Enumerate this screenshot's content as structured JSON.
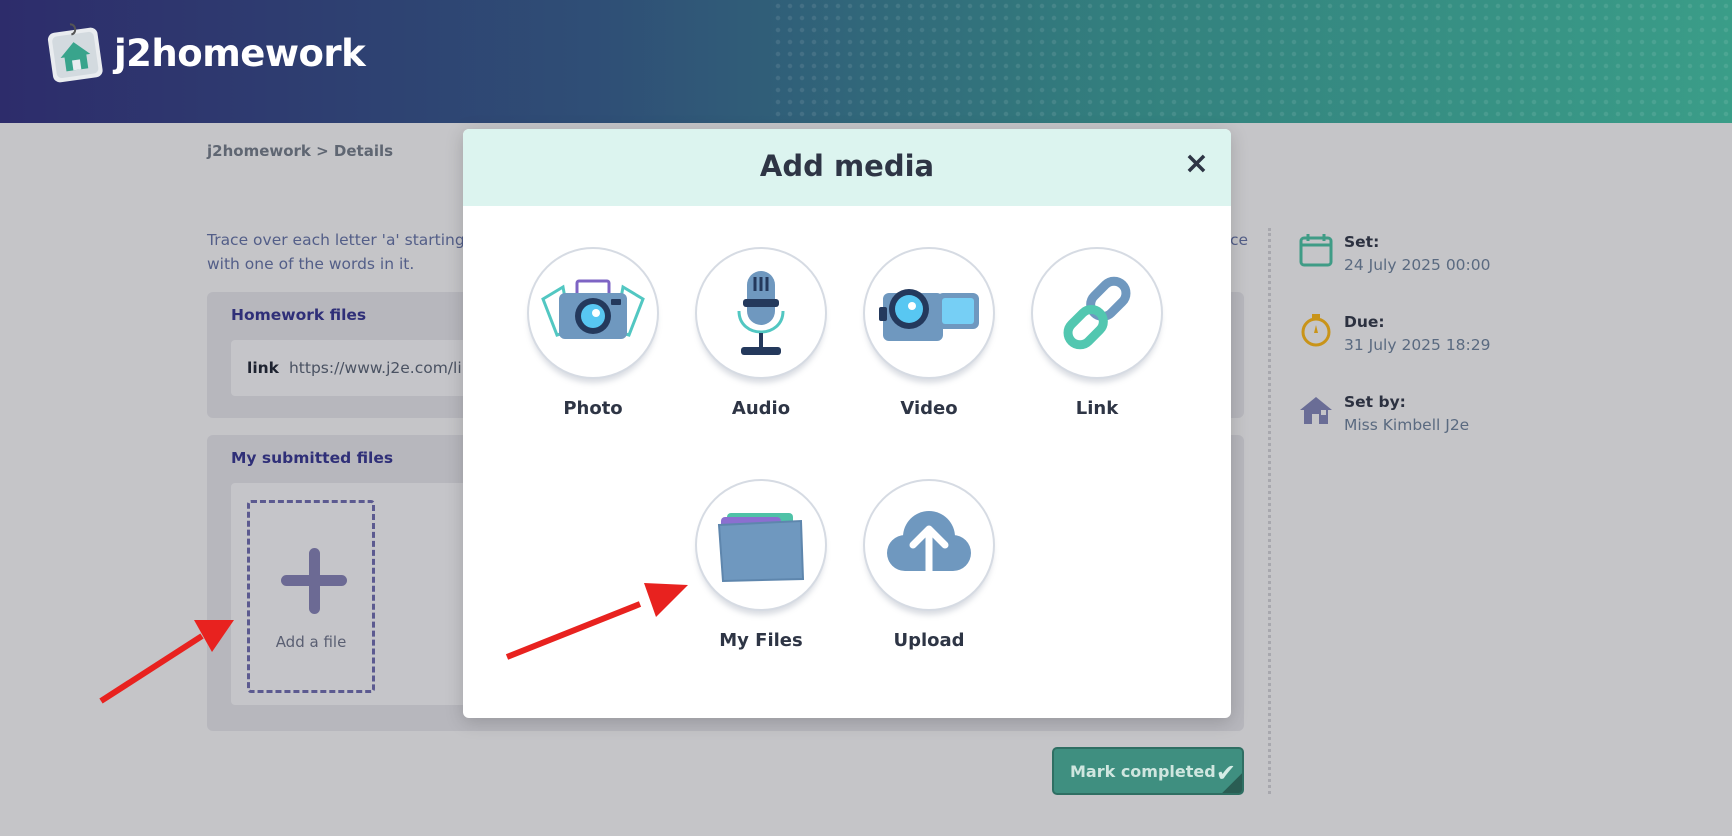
{
  "header": {
    "logo_text": "j2homework"
  },
  "breadcrumb": "j2homework > Details",
  "description": {
    "line1_start": "Trace over each letter 'a' starting",
    "line1_end": "ce",
    "line2": "with one of the words in it."
  },
  "homework_files": {
    "title": "Homework files",
    "link_tag": "link",
    "link_url": "https://www.j2e.com/li"
  },
  "submitted_files": {
    "title": "My submitted files",
    "add_file_label": "Add a file"
  },
  "mark_completed": {
    "label": "Mark completed",
    "icon": "check-icon"
  },
  "sidebar": {
    "set": {
      "label": "Set:",
      "value": "24 July 2025 00:00",
      "icon": "calendar-icon"
    },
    "due": {
      "label": "Due:",
      "value": "31 July 2025 18:29",
      "icon": "stopwatch-icon"
    },
    "set_by": {
      "label": "Set by:",
      "value": "Miss Kimbell J2e",
      "icon": "house-icon"
    }
  },
  "modal": {
    "title": "Add media",
    "close": "×",
    "options": [
      {
        "label": "Photo",
        "icon": "camera-icon"
      },
      {
        "label": "Audio",
        "icon": "microphone-icon"
      },
      {
        "label": "Video",
        "icon": "video-camera-icon"
      },
      {
        "label": "Link",
        "icon": "link-icon"
      },
      {
        "label": "My Files",
        "icon": "folder-icon"
      },
      {
        "label": "Upload",
        "icon": "cloud-upload-icon"
      }
    ]
  },
  "colors": {
    "header_start": "#2d2c6b",
    "header_end": "#3a9d88",
    "modal_header": "#dcf4ef",
    "accent_green": "#3f8f80",
    "arrow_red": "#e8221f"
  }
}
